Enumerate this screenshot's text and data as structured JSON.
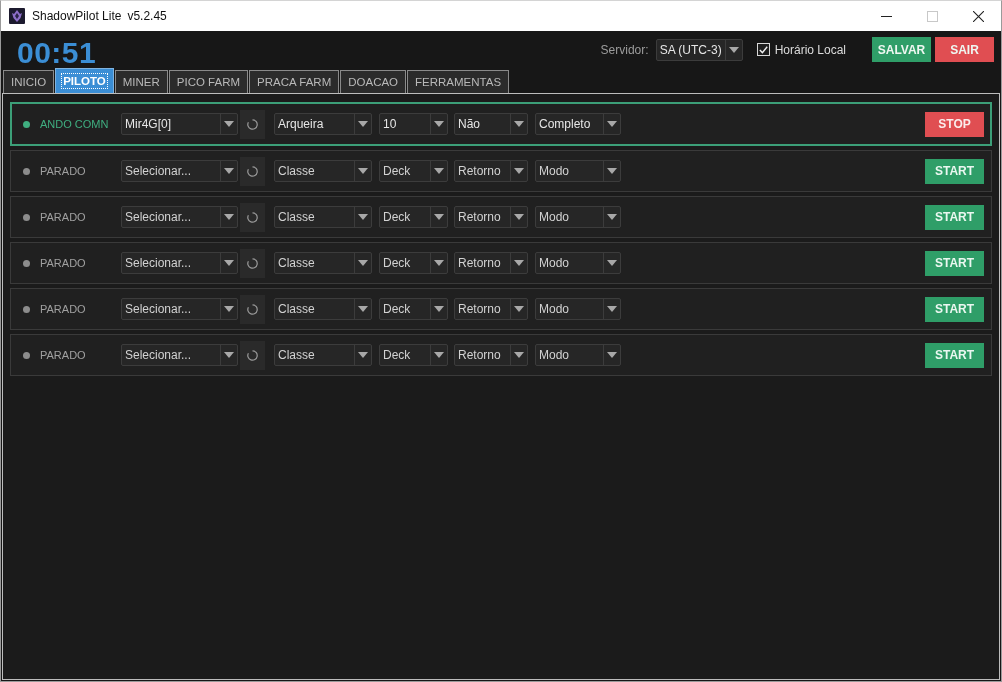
{
  "window": {
    "title": "ShadowPilot Lite",
    "version": "v5.2.45",
    "controls": [
      {
        "kind": "minimize",
        "disabled": false
      },
      {
        "kind": "maximize",
        "disabled": true
      },
      {
        "kind": "close",
        "disabled": false
      }
    ]
  },
  "header": {
    "timer": "00:51",
    "server": {
      "label": "Servidor:",
      "value": "SA (UTC-3)"
    },
    "local_time": {
      "label": "Horário Local",
      "checked": true
    },
    "buttons": [
      {
        "kind": "save",
        "label": "SALVAR"
      },
      {
        "kind": "exit",
        "label": "SAIR"
      }
    ]
  },
  "tabs": [
    {
      "label": "INICIO",
      "selected": false
    },
    {
      "label": "PILOTO",
      "selected": true
    },
    {
      "label": "MINER",
      "selected": false
    },
    {
      "label": "PICO FARM",
      "selected": false
    },
    {
      "label": "PRACA FARM",
      "selected": false
    },
    {
      "label": "DOACAO",
      "selected": false
    },
    {
      "label": "FERRAMENTAS",
      "selected": false
    }
  ],
  "pilots": [
    {
      "running": true,
      "status": "ANDO COMN",
      "account": {
        "value": "Mir4G[0]"
      },
      "class": {
        "value": "Arqueira"
      },
      "deck": {
        "value": "10"
      },
      "return": {
        "value": "Não"
      },
      "mode": {
        "value": "Completo"
      },
      "action": "STOP"
    },
    {
      "running": false,
      "status": "PARADO",
      "account": {
        "placeholder": "Selecionar..."
      },
      "class": {
        "placeholder": "Classe"
      },
      "deck": {
        "placeholder": "Deck"
      },
      "return": {
        "placeholder": "Retorno"
      },
      "mode": {
        "placeholder": "Modo"
      },
      "action": "START"
    },
    {
      "running": false,
      "status": "PARADO",
      "account": {
        "placeholder": "Selecionar..."
      },
      "class": {
        "placeholder": "Classe"
      },
      "deck": {
        "placeholder": "Deck"
      },
      "return": {
        "placeholder": "Retorno"
      },
      "mode": {
        "placeholder": "Modo"
      },
      "action": "START"
    },
    {
      "running": false,
      "status": "PARADO",
      "account": {
        "placeholder": "Selecionar..."
      },
      "class": {
        "placeholder": "Classe"
      },
      "deck": {
        "placeholder": "Deck"
      },
      "return": {
        "placeholder": "Retorno"
      },
      "mode": {
        "placeholder": "Modo"
      },
      "action": "START"
    },
    {
      "running": false,
      "status": "PARADO",
      "account": {
        "placeholder": "Selecionar..."
      },
      "class": {
        "placeholder": "Classe"
      },
      "deck": {
        "placeholder": "Deck"
      },
      "return": {
        "placeholder": "Retorno"
      },
      "mode": {
        "placeholder": "Modo"
      },
      "action": "START"
    },
    {
      "running": false,
      "status": "PARADO",
      "account": {
        "placeholder": "Selecionar..."
      },
      "class": {
        "placeholder": "Classe"
      },
      "deck": {
        "placeholder": "Deck"
      },
      "return": {
        "placeholder": "Retorno"
      },
      "mode": {
        "placeholder": "Modo"
      },
      "action": "START"
    }
  ]
}
